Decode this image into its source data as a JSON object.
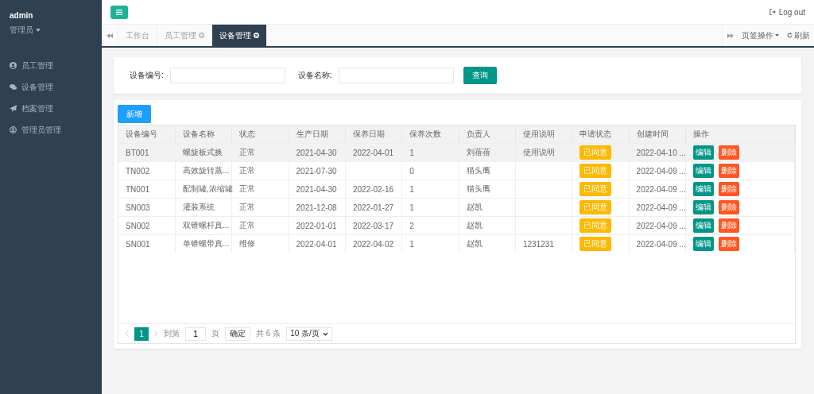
{
  "user": {
    "name": "admin",
    "role": "管理员"
  },
  "sidebar": {
    "items": [
      {
        "label": "员工管理"
      },
      {
        "label": "设备管理"
      },
      {
        "label": "档案管理"
      },
      {
        "label": "管理员管理"
      }
    ]
  },
  "header": {
    "logout": "Log out"
  },
  "tabs": [
    {
      "label": "工作台",
      "closable": false,
      "selected": false
    },
    {
      "label": "员工管理",
      "closable": true,
      "selected": false
    },
    {
      "label": "设备管理",
      "closable": true,
      "selected": true
    }
  ],
  "tab_actions": {
    "menu": "页签操作",
    "refresh": "刷新"
  },
  "search": {
    "fields": [
      {
        "label": "设备编号:"
      },
      {
        "label": "设备名称:"
      }
    ],
    "button": "查询"
  },
  "add_button": "新增",
  "table": {
    "columns": [
      "设备编号",
      "设备名称",
      "状态",
      "生产日期",
      "保养日期",
      "保养次数",
      "负责人",
      "使用说明",
      "申请状态",
      "创建时间",
      "操作"
    ],
    "rows": [
      {
        "selected": true,
        "cells": [
          "BT001",
          "螺旋板式换",
          "正常",
          "2021-04-30",
          "2022-04-01",
          "1",
          "刘蓓蓓",
          "使用说明"
        ],
        "status": "已同意",
        "created": "2022-04-10 ...",
        "edit": "编辑",
        "delete": "删除"
      },
      {
        "selected": false,
        "cells": [
          "TN002",
          "高效旋转蒸...",
          "正常",
          "2021-07-30",
          "",
          "0",
          "猫头鹰",
          ""
        ],
        "status": "已同意",
        "created": "2022-04-09 ...",
        "edit": "编辑",
        "delete": "删除"
      },
      {
        "selected": false,
        "cells": [
          "TN001",
          "配制罐,浓缩罐",
          "正常",
          "2021-04-30",
          "2022-02-16",
          "1",
          "猫头鹰",
          ""
        ],
        "status": "已同意",
        "created": "2022-04-09 ...",
        "edit": "编辑",
        "delete": "删除"
      },
      {
        "selected": false,
        "cells": [
          "SN003",
          "灌装系统",
          "正常",
          "2021-12-08",
          "2022-01-27",
          "1",
          "赵凯",
          ""
        ],
        "status": "已同意",
        "created": "2022-04-09 ...",
        "edit": "编辑",
        "delete": "删除"
      },
      {
        "selected": false,
        "cells": [
          "SN002",
          "双锥螺杆真...",
          "正常",
          "2022-01-01",
          "2022-03-17",
          "2",
          "赵凯",
          ""
        ],
        "status": "已同意",
        "created": "2022-04-09 ...",
        "edit": "编辑",
        "delete": "删除"
      },
      {
        "selected": false,
        "cells": [
          "SN001",
          "单锥螺带真...",
          "维修",
          "2022-04-01",
          "2022-04-02",
          "1",
          "赵凯",
          "1231231"
        ],
        "status": "已同意",
        "created": "2022-04-09 ...",
        "edit": "编辑",
        "delete": "删除"
      }
    ]
  },
  "pagination": {
    "current": "1",
    "goto_label": "到第",
    "goto_value": "1",
    "page_unit": "页",
    "confirm": "确定",
    "total": "共 6 条",
    "page_size": "10 条/页"
  }
}
